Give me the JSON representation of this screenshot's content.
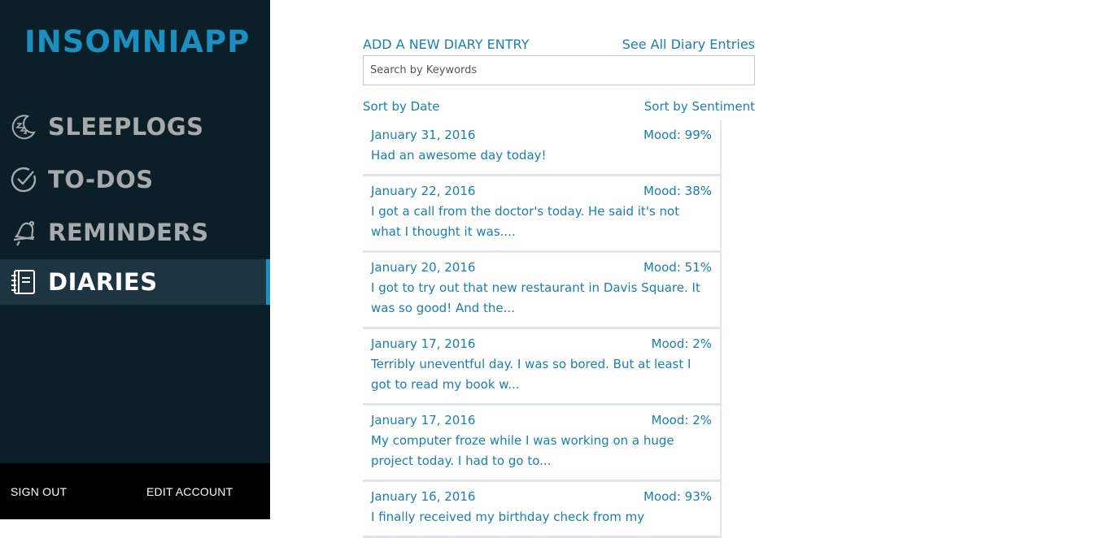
{
  "app": {
    "title": "INSOMNIAPP"
  },
  "sidebar": {
    "items": [
      {
        "label": "SLEEPLOGS",
        "icon": "moon-zzz-icon",
        "active": false
      },
      {
        "label": "TO-DOS",
        "icon": "check-circle-icon",
        "active": false
      },
      {
        "label": "REMINDERS",
        "icon": "bell-icon",
        "active": false
      },
      {
        "label": "DIARIES",
        "icon": "notebook-icon",
        "active": true
      }
    ],
    "footer": {
      "sign_out": "SIGN OUT",
      "edit_account": "EDIT ACCOUNT"
    }
  },
  "main": {
    "add_entry": "ADD A NEW DIARY ENTRY",
    "see_all": "See All Diary Entries",
    "search_placeholder": "Search by Keywords",
    "sort_date": "Sort by Date",
    "sort_sentiment": "Sort by Sentiment",
    "entries": [
      {
        "date": "January 31, 2016",
        "mood": "Mood: 99%",
        "text": "Had an awesome day today!"
      },
      {
        "date": "January 22, 2016",
        "mood": "Mood: 38%",
        "text": "I got a call from the doctor's today. He said it's not what I thought it was...."
      },
      {
        "date": "January 20, 2016",
        "mood": "Mood: 51%",
        "text": "I got to try out that new restaurant in Davis Square. It was so good! And the..."
      },
      {
        "date": "January 17, 2016",
        "mood": "Mood: 2%",
        "text": "Terribly uneventful day. I was so bored. But at least I got to read my book w..."
      },
      {
        "date": "January 17, 2016",
        "mood": "Mood: 2%",
        "text": "My computer froze while I was working on a huge project today. I had to go to..."
      },
      {
        "date": "January 16, 2016",
        "mood": "Mood: 93%",
        "text": "I finally received my birthday check from my"
      }
    ]
  },
  "colors": {
    "accent": "#1a8fc0",
    "sidebar_bg": "#0b1f28",
    "active_bg": "#1c3541",
    "link": "#1a7fb0"
  }
}
